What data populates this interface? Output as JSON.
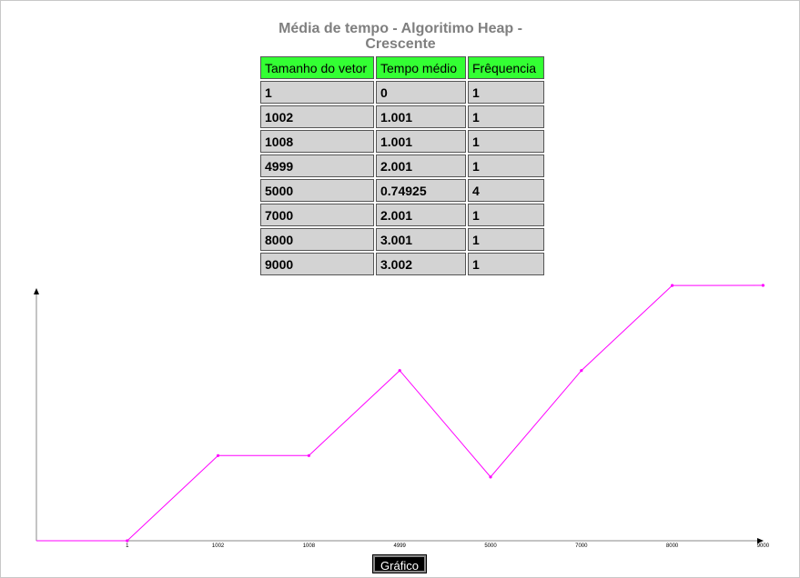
{
  "title": "Média de tempo - Algoritimo Heap - Crescente",
  "table": {
    "headers": [
      "Tamanho do vetor",
      "Tempo médio",
      "Frêquencia"
    ],
    "rows": [
      [
        "1",
        "0",
        "1"
      ],
      [
        "1002",
        "1.001",
        "1"
      ],
      [
        "1008",
        "1.001",
        "1"
      ],
      [
        "4999",
        "2.001",
        "1"
      ],
      [
        "5000",
        "0.74925",
        "4"
      ],
      [
        "7000",
        "2.001",
        "1"
      ],
      [
        "8000",
        "3.001",
        "1"
      ],
      [
        "9000",
        "3.002",
        "1"
      ]
    ]
  },
  "chart_data": {
    "type": "line",
    "categories": [
      "1",
      "1002",
      "1008",
      "4999",
      "5000",
      "7000",
      "8000",
      "9000"
    ],
    "series": [
      {
        "values": [
          0,
          1.001,
          1.001,
          2.001,
          0.74925,
          2.001,
          3.001,
          3.002
        ]
      }
    ],
    "ylim": [
      0,
      3.002
    ],
    "grid": false,
    "line_color": "#ff00ff",
    "axis_color": "#888888"
  },
  "button": {
    "label": "Gráfico"
  }
}
